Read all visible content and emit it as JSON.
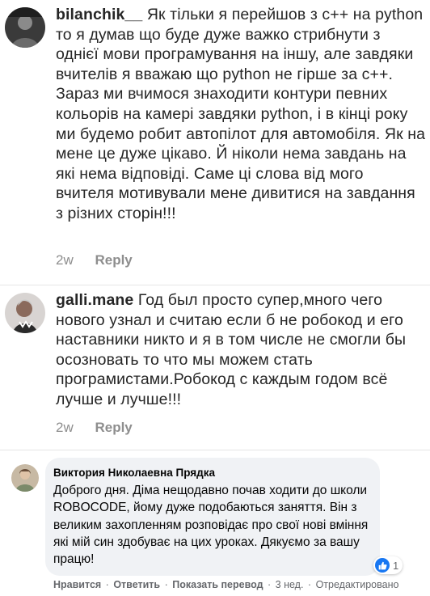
{
  "comments": [
    {
      "username": "bilanchik__",
      "text": "Як тільки я перейшов з с++ на python то я думав що буде дуже важко стрибнути з однієї мови програмування на іншу, але завдяки вчителів я вважаю що python не гірше за с++. Зараз ми вчимося знаходити контури певних кольорів на камері завдяки python, і в кінці року ми будемо робит автопілот для автомобіля. Як на мене це дуже цікаво. Й ніколи нема завдань на які нема відповіді. Саме ці слова від мого вчителя мотивували мене дивитися на завдання з різних сторін!!!",
      "time": "2w",
      "reply_label": "Reply"
    },
    {
      "username": "galli.mane",
      "text": "Год был просто супер,много чего нового узнал и считаю если б не робокод и его наставники никто и я в том числе не смогли бы осозновать то что мы можем стать програмистами.Робокод с каждым годом всё лучше и лучше!!!",
      "time": "2w",
      "reply_label": "Reply"
    }
  ],
  "fb_comment": {
    "author": "Виктория Николаевна Прядка",
    "text": "Доброго дня. Діма нещодавно почав ходити до школи ROBOCODE, йому дуже подобаються заняття. Він з великим захопленням розповідає про свої нові вміння які мій син здобуває на цих уроках. Дякуємо за вашу працю!",
    "reaction_count": "1",
    "actions": {
      "like": "Нравится",
      "reply": "Ответить",
      "translate": "Показать перевод",
      "time": "3 нед.",
      "edited": "Отредактировано"
    }
  },
  "colors": {
    "ig_text": "#262626",
    "ig_meta": "#8e8e8e",
    "fb_bubble": "#f0f2f5",
    "fb_like": "#1877f2"
  }
}
